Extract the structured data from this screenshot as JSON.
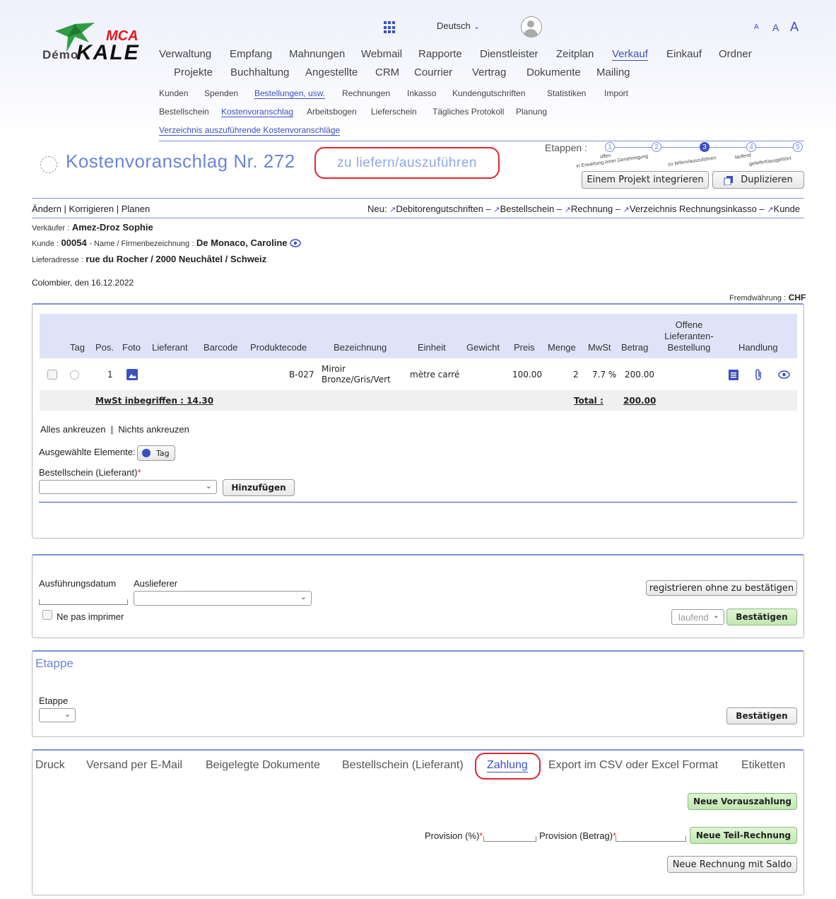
{
  "header": {
    "logo_demo": "Démo",
    "logo_brand": "KALE",
    "logo_mca": "MCA",
    "language": "Deutsch",
    "font_sizes": [
      "A",
      "A",
      "A"
    ]
  },
  "nav_main": [
    "Verwaltung",
    "Empfang",
    "Mahnungen",
    "Webmail",
    "Rapporte",
    "Dienstleister",
    "Zeitplan",
    "Verkauf",
    "Einkauf",
    "Ordner",
    "Projekte",
    "Buchhaltung",
    "Angestellte",
    "CRM",
    "Courrier",
    "Vertrag",
    "Dokumente",
    "Mailing"
  ],
  "nav_sub": [
    "Kunden",
    "Spenden",
    "Bestellungen, usw.",
    "Rechnungen",
    "Inkasso",
    "Kundengutschriften",
    "Statistiken",
    "Import"
  ],
  "nav_sub2": [
    "Bestellschein",
    "Kostenvoranschlag",
    "Arbeitsbogen",
    "Lieferschein",
    "Tägliches Protokoll",
    "Planung"
  ],
  "nav_sub3": "Verzeichnis auszuführende Kostenvoranschläge",
  "doc": {
    "title": "Kostenvoranschlag Nr. 272",
    "status": "zu liefern/auszuführen",
    "etappen_label": "Etappen :",
    "steps": [
      "1",
      "2",
      "3",
      "4",
      "5"
    ],
    "step_labels": [
      "offen",
      "in Erwartung einer Genehmigung",
      "zu liefern/auszuführen",
      "laufend",
      "geliefert/ausgeführt"
    ],
    "btn_project": "Einem Projekt integrieren",
    "btn_duplicate": "Duplizieren"
  },
  "actions": {
    "left": "Ändern | Korrigieren | Planen",
    "neu_label": "Neu:",
    "links": [
      "Debitorengutschriften",
      "Bestellschein",
      "Rechnung",
      "Verzeichnis Rechnungsinkasso",
      "Kunde"
    ],
    "sep": "–"
  },
  "info": {
    "seller_label": "Verkäufer :",
    "seller": "Amez-Droz Sophie",
    "client_label": "Kunde :",
    "client_no": "00054",
    "name_label": "- Name / Firmenbezeichnung :",
    "client_name": "De Monaco, Caroline",
    "delivery_label": "Lieferadresse :",
    "delivery": "rue du Rocher / 2000 Neuchâtel / Schweiz",
    "place_date": "Colombier, den 16.12.2022",
    "currency_label": "Fremdwährung :",
    "currency": "CHF"
  },
  "table": {
    "headers": [
      "Tag",
      "Pos.",
      "Foto",
      "Lieferant",
      "Barcode",
      "Produktecode",
      "Bezeichnung",
      "Einheit",
      "Gewicht",
      "Preis",
      "Menge",
      "MwSt",
      "Betrag",
      "Offene Lieferanten-Bestellung",
      "Handlung"
    ],
    "header_offene": [
      "Offene",
      "Lieferanten-",
      "Bestellung"
    ],
    "row": {
      "pos": "1",
      "code": "B-027",
      "desc1": "Miroir",
      "desc2": "Bronze/Gris/Vert",
      "unit": "mètre carré",
      "price": "100.00",
      "qty": "2",
      "vat": "7.7 %",
      "amount": "200.00"
    },
    "vat_incl": "MwSt inbegriffen : 14.30",
    "total_label": "Total :",
    "total": "200.00"
  },
  "select_ctrl": {
    "all": "Alles ankreuzen",
    "sep": "|",
    "none": "Nichts ankreuzen",
    "selected_label": "Ausgewählte Elemente:",
    "tag_btn": "Tag",
    "po_label": "Bestellschein (Lieferant)",
    "req": "*",
    "add_btn": "Hinzufügen"
  },
  "exec": {
    "date_label": "Ausführungsdatum",
    "deliverer_label": "Auslieferer",
    "no_print": "Ne pas imprimer",
    "register_btn": "registrieren ohne zu bestätigen",
    "state_select": "laufend",
    "confirm_btn": "Bestätigen"
  },
  "etappe": {
    "title": "Etappe",
    "label": "Etappe",
    "confirm_btn": "Bestätigen"
  },
  "tabs": [
    "Druck",
    "Versand per E-Mail",
    "Beigelegte Dokumente",
    "Bestellschein (Lieferant)",
    "Zahlung",
    "Export im CSV oder Excel Format",
    "Etiketten"
  ],
  "payment": {
    "new_prepay": "Neue Vorauszahlung",
    "prov_pct_label": "Provision (%)",
    "prov_amt_label": "Provision (Betrag)",
    "req": "*",
    "new_partial": "Neue Teil-Rechnung",
    "new_balance": "Neue Rechnung mit Saldo"
  },
  "colors": {
    "accent": "#3b4fc2",
    "highlight": "#e0262f",
    "title": "#6b85d6"
  }
}
